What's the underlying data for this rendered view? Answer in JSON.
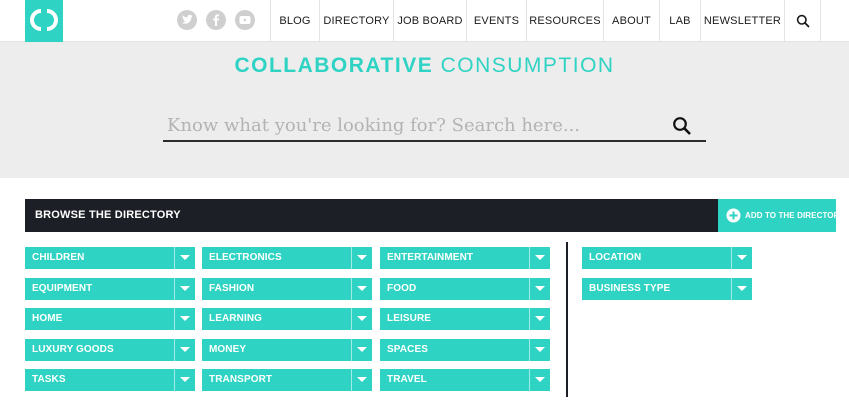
{
  "header": {
    "nav": [
      "BLOG",
      "DIRECTORY",
      "JOB BOARD",
      "EVENTS",
      "RESOURCES",
      "ABOUT",
      "LAB",
      "NEWSLETTER"
    ],
    "social_icons": [
      "twitter-icon",
      "facebook-icon",
      "youtube-icon"
    ],
    "search_icon": "search-icon"
  },
  "hero": {
    "title_bold": "COLLABORATIVE",
    "title_light": "CONSUMPTION",
    "search_placeholder": "Know what you're looking for? Search here..."
  },
  "browse": {
    "title": "BROWSE THE DIRECTORY",
    "add_label": "ADD TO THE DIRECTORY"
  },
  "categories": {
    "col1": [
      "CHILDREN",
      "EQUIPMENT",
      "HOME",
      "LUXURY GOODS",
      "TASKS"
    ],
    "col2": [
      "ELECTRONICS",
      "FASHION",
      "LEARNING",
      "MONEY",
      "TRANSPORT"
    ],
    "col3": [
      "ENTERTAINMENT",
      "FOOD",
      "LEISURE",
      "SPACES",
      "TRAVEL"
    ],
    "col4": [
      "LOCATION",
      "BUSINESS TYPE"
    ]
  },
  "colors": {
    "accent": "#2fd3c3",
    "dark": "#1c1f26",
    "hero_bg": "#ededed"
  }
}
